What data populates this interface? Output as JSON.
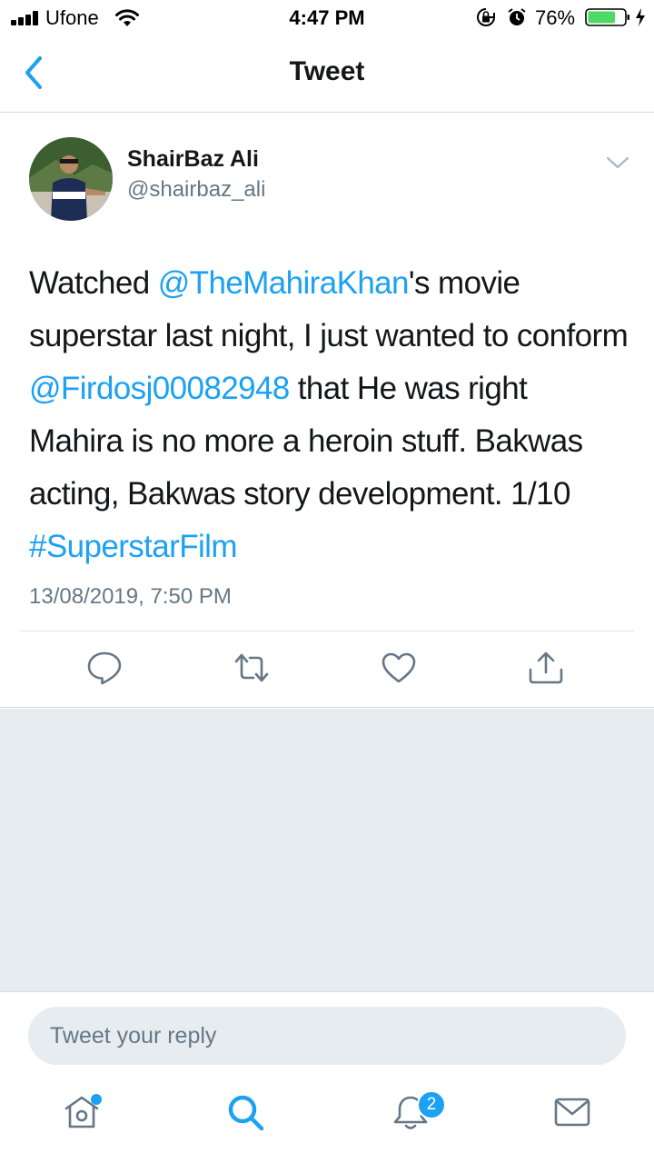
{
  "status_bar": {
    "carrier": "Ufone",
    "time": "4:47 PM",
    "battery_percent": "76%",
    "battery_level": 0.76
  },
  "header": {
    "title": "Tweet",
    "back_icon": "chevron-left-icon"
  },
  "tweet": {
    "display_name": "ShairBaz Ali",
    "handle": "@shairbaz_ali",
    "text_parts": {
      "p1": "Watched ",
      "mention1": "@TheMahiraKhan",
      "p2": "'s movie superstar last night, I just wanted to conform ",
      "mention2": "@Firdosj00082948",
      "p3": " that He was right Mahira is no more a heroin stuff. Bakwas acting, Bakwas story development. 1/10 ",
      "hashtag": "#SuperstarFilm"
    },
    "timestamp": "13/08/2019, 7:50 PM",
    "actions": [
      "reply-icon",
      "retweet-icon",
      "like-icon",
      "share-icon"
    ]
  },
  "reply": {
    "placeholder": "Tweet your reply"
  },
  "tab_bar": {
    "tabs": [
      "home-icon",
      "search-icon",
      "notifications-icon",
      "messages-icon"
    ],
    "notifications_badge": "2"
  },
  "colors": {
    "accent": "#1da1f2",
    "text": "#14171a",
    "secondary": "#657786",
    "background_gray": "#e6ecf0",
    "battery_green": "#4cd964"
  }
}
